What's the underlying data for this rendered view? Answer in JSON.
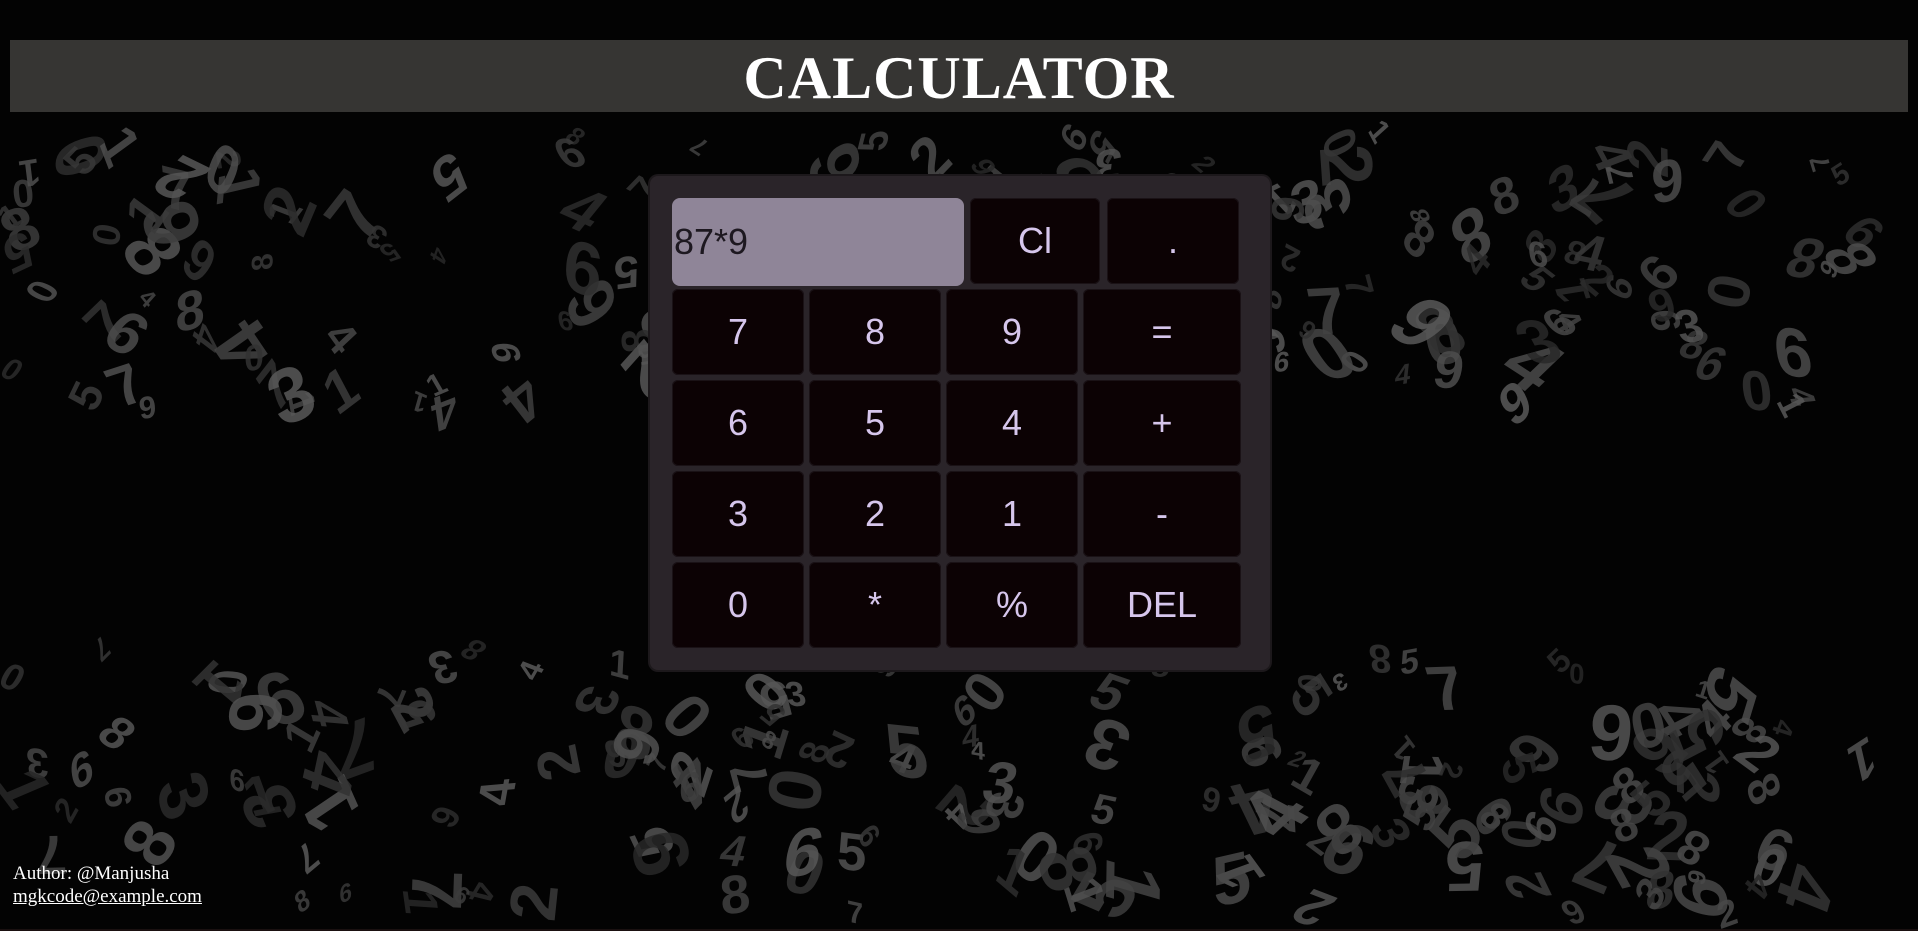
{
  "header": {
    "title": "CALCULATOR"
  },
  "calculator": {
    "display_value": "87*9",
    "buttons": {
      "clear": "Cl",
      "dot": ".",
      "seven": "7",
      "eight": "8",
      "nine": "9",
      "equals": "=",
      "six": "6",
      "five": "5",
      "four": "4",
      "plus": "+",
      "three": "3",
      "two": "2",
      "one": "1",
      "minus": "-",
      "zero": "0",
      "multiply": "*",
      "percent": "%",
      "delete": "DEL"
    }
  },
  "footer": {
    "author": "Author: @Manjusha",
    "email": "mgkcode@example.com"
  },
  "colors": {
    "header_bar": "#363533",
    "panel": "#2a2429",
    "button_bg": "#0c0204",
    "button_text": "#d6c6ec",
    "display_bg": "#8f8598"
  }
}
